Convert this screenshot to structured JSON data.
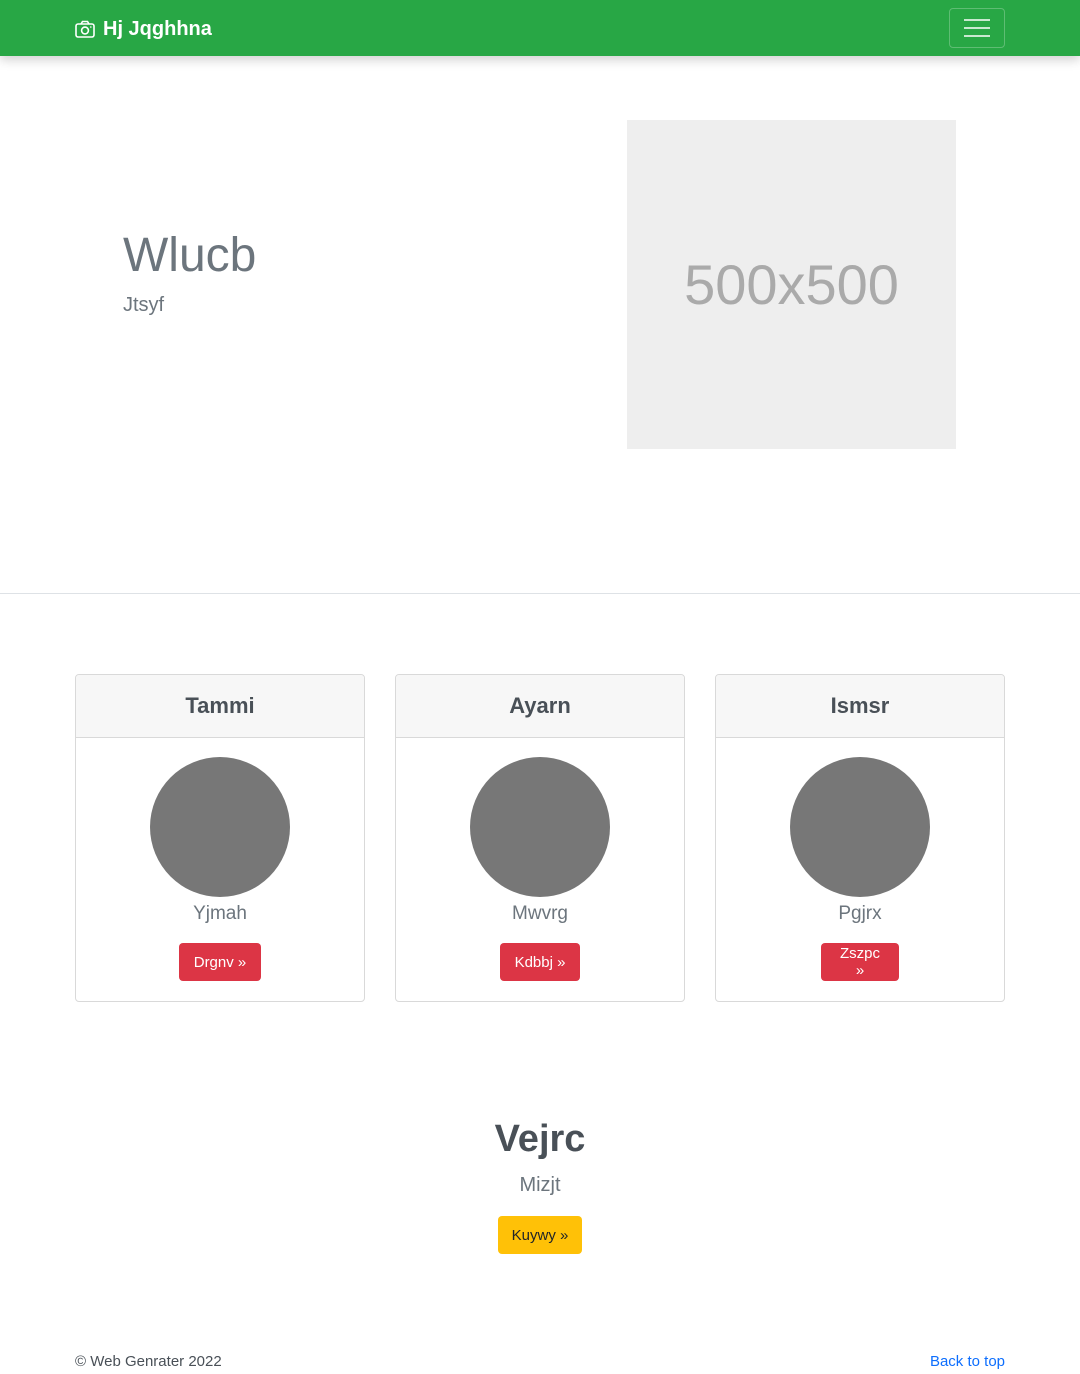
{
  "navbar": {
    "brand_icon": "camera-icon",
    "brand": "Hj Jqghhna",
    "toggler_icon": "hamburger-menu-icon",
    "color": "#28a745"
  },
  "hero": {
    "title": "Wlucb",
    "subtitle": "Jtsyf",
    "image_label": "500x500"
  },
  "cards": [
    {
      "header": "Tammi",
      "name": "Yjmah",
      "button": "Drgnv »"
    },
    {
      "header": "Ayarn",
      "name": "Mwvrg",
      "button": "Kdbbj »"
    },
    {
      "header": "Ismsr",
      "name": "Pgjrx",
      "button": "Zszpc »"
    }
  ],
  "feature": {
    "title": "Vejrc",
    "subtitle": "Mizjt",
    "button": "Kuywy »"
  },
  "footer": {
    "copyright": "© Web Genrater 2022",
    "back_to_top": "Back to top"
  },
  "colors": {
    "danger": "#dc3545",
    "warning": "#ffc107",
    "link": "#0d6efd"
  }
}
